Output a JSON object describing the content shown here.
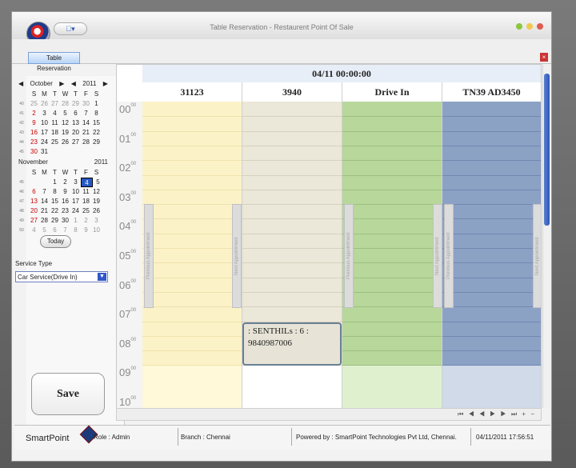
{
  "window": {
    "title": "Table Reservation - Restaurent Point Of Sale",
    "menu": "▾"
  },
  "tabs": [
    {
      "label": "Table Reservation"
    }
  ],
  "calendar_october": {
    "month": "October",
    "year": "2011",
    "weekdays": [
      "S",
      "M",
      "T",
      "W",
      "T",
      "F",
      "S"
    ],
    "weeks": [
      [
        "25",
        "26",
        "27",
        "28",
        "29",
        "30",
        "1"
      ],
      [
        "2",
        "3",
        "4",
        "5",
        "6",
        "7",
        "8"
      ],
      [
        "9",
        "10",
        "11",
        "12",
        "13",
        "14",
        "15"
      ],
      [
        "16",
        "17",
        "18",
        "19",
        "20",
        "21",
        "22"
      ],
      [
        "23",
        "24",
        "25",
        "26",
        "27",
        "28",
        "29"
      ],
      [
        "30",
        "31",
        "",
        "",
        "",
        "",
        ""
      ]
    ]
  },
  "calendar_november": {
    "month": "November",
    "year": "2011",
    "weekdays": [
      "S",
      "M",
      "T",
      "W",
      "T",
      "F",
      "S"
    ],
    "weeks": [
      [
        "",
        "",
        "1",
        "2",
        "3",
        "4",
        "5"
      ],
      [
        "6",
        "7",
        "8",
        "9",
        "10",
        "11",
        "12"
      ],
      [
        "13",
        "14",
        "15",
        "16",
        "17",
        "18",
        "19"
      ],
      [
        "20",
        "21",
        "22",
        "23",
        "24",
        "25",
        "26"
      ],
      [
        "27",
        "28",
        "29",
        "30",
        "1",
        "2",
        "3"
      ],
      [
        "4",
        "5",
        "6",
        "7",
        "8",
        "9",
        "10"
      ]
    ]
  },
  "today_button": "Today",
  "service": {
    "label": "Service Type",
    "value": "Car Service(Drive In)"
  },
  "save_button": "Save",
  "schedule": {
    "date_header": "04/11 00:00:00",
    "columns": [
      "31123",
      "3940",
      "Drive In",
      "TN39 AD3450"
    ],
    "times": [
      "00",
      "01",
      "02",
      "03",
      "04",
      "05",
      "06",
      "07",
      "08",
      "09",
      "10"
    ],
    "appointment": {
      "line1": ": SENTHILs : 6 :",
      "line2": "9840987006"
    },
    "side_tabs": {
      "prev": "Previous Appointment",
      "next": "Next Appointment"
    }
  },
  "status_bar": {
    "brand": "SmartPoint",
    "role": "Role  : Admin",
    "branch": "Branch : Chennai",
    "powered": "Powered by : SmartPoint Technologies Pvt Ltd, Chennai.",
    "timestamp": "04/11/2011 17:56:51"
  },
  "colors": {
    "lane1": "#fbf2c8",
    "lane2": "#ebe7d9",
    "lane3": "#b7d79b",
    "lane4": "#8ca2c5",
    "accent": "#2f58c1"
  }
}
